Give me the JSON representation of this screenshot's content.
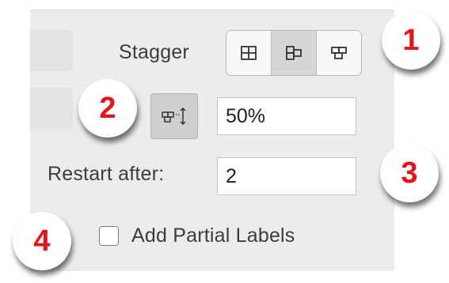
{
  "stagger": {
    "label": "Stagger",
    "options": [
      {
        "icon": "grid-aligned-icon",
        "selected": false
      },
      {
        "icon": "grid-stagger-row-icon",
        "selected": true
      },
      {
        "icon": "grid-stagger-column-icon",
        "selected": false
      }
    ]
  },
  "offset": {
    "icon": "stagger-offset-icon",
    "value": "50%"
  },
  "restart": {
    "label": "Restart after:",
    "value": "2"
  },
  "partial_labels": {
    "label": "Add Partial Labels",
    "checked": false
  },
  "callouts": [
    "1",
    "2",
    "3",
    "4"
  ],
  "colors": {
    "callout_text": "#e4141c",
    "panel_bg": "#ececec"
  }
}
